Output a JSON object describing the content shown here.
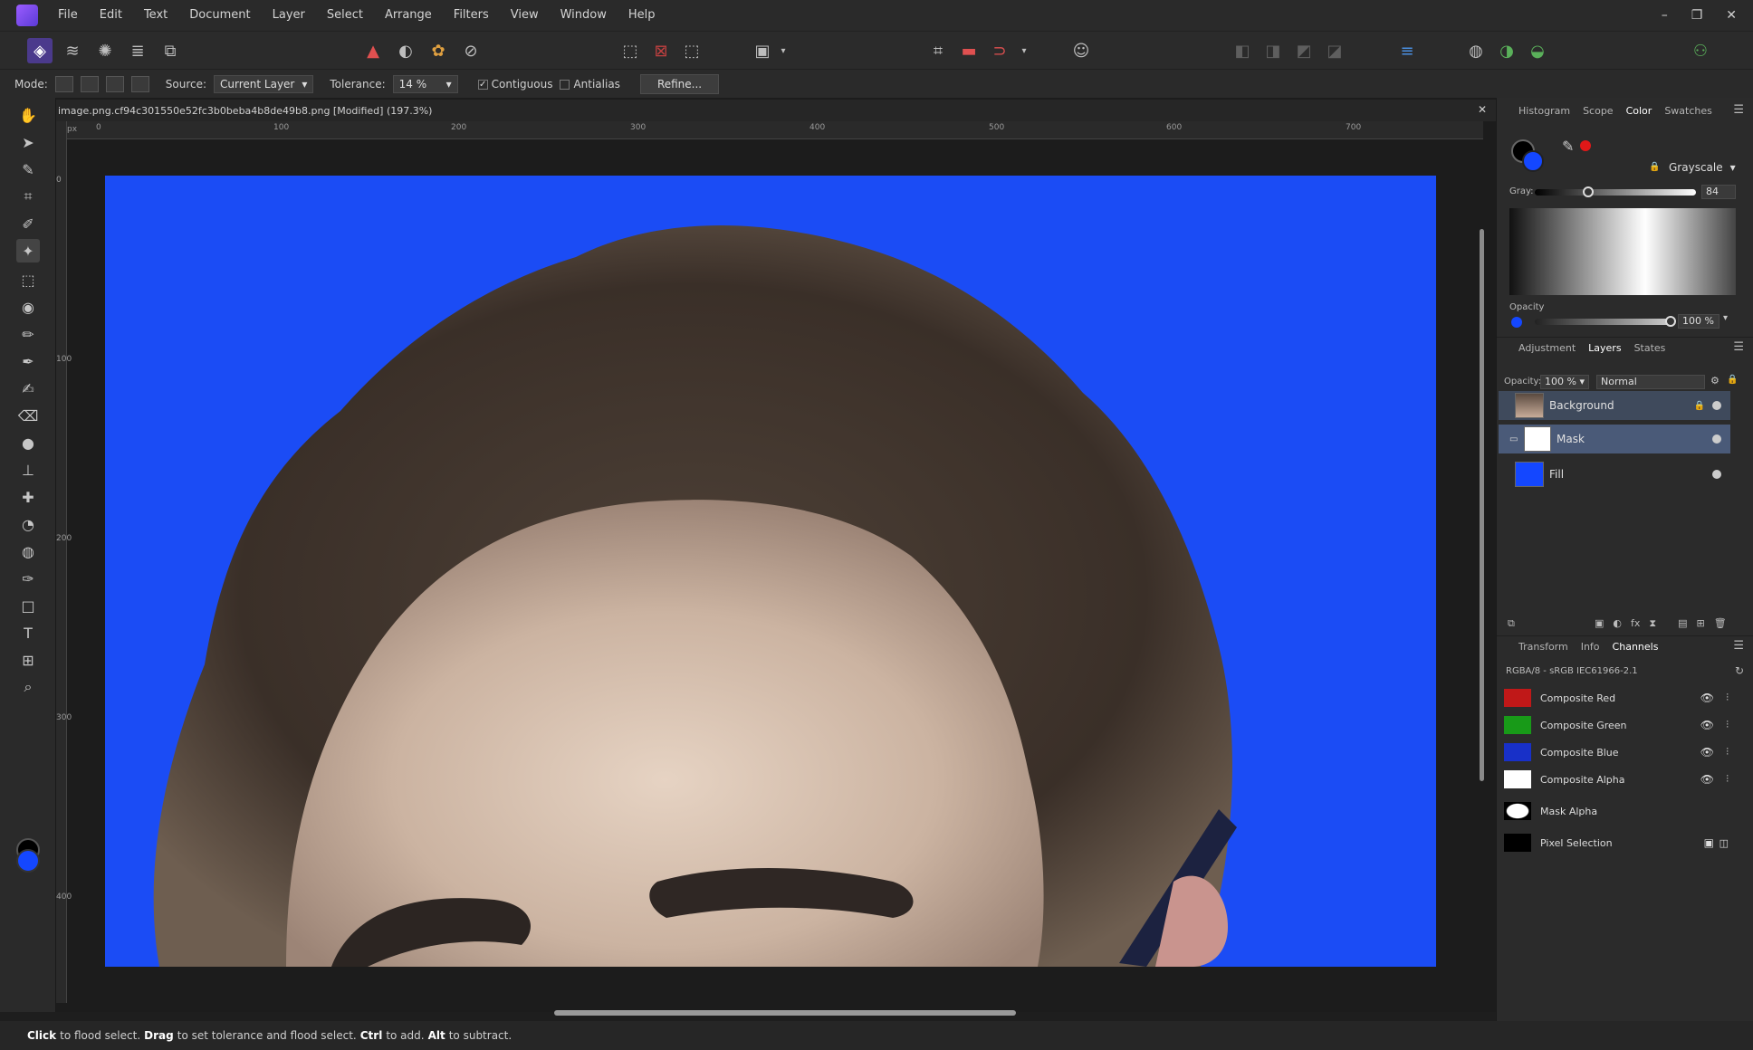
{
  "menu": [
    "File",
    "Edit",
    "Text",
    "Document",
    "Layer",
    "Select",
    "Arrange",
    "Filters",
    "View",
    "Window",
    "Help"
  ],
  "window": {
    "minimize": "–",
    "restore": "❐",
    "close": "✕"
  },
  "context": {
    "mode_label": "Mode:",
    "source_label": "Source:",
    "source_value": "Current Layer",
    "tolerance_label": "Tolerance:",
    "tolerance_value": "14 %",
    "contiguous_label": "Contiguous",
    "antialias_label": "Antialias",
    "refine_label": "Refine..."
  },
  "document": {
    "tab_title": "image.png.cf94c301550e52fc3b0beba4b8de49b8.png [Modified] (197.3%)",
    "ruler_unit": "px",
    "ruler_top": [
      "0",
      "100",
      "200",
      "300",
      "400",
      "500",
      "600",
      "700"
    ],
    "ruler_left": [
      "0",
      "100",
      "200",
      "300",
      "400"
    ]
  },
  "status": {
    "click": "Click",
    "t1": "to flood select.",
    "drag": "Drag",
    "t2": "to set tolerance and flood select.",
    "ctrl": "Ctrl",
    "t3": "to add.",
    "alt": "Alt",
    "t4": "to subtract."
  },
  "color_panel": {
    "tabs": [
      "Histogram",
      "Scope",
      "Color",
      "Swatches"
    ],
    "model": "Grayscale",
    "gray_label": "Gray:",
    "gray_value": "84",
    "gray_level": 0.33,
    "opacity_label": "Opacity",
    "opacity_value": "100 %",
    "opacity_level": 1.0,
    "fg_color": "#000000",
    "bg_color": "#1447ff"
  },
  "layers_panel": {
    "tabs": [
      "Adjustment",
      "Layers",
      "States"
    ],
    "opacity_label": "Opacity:",
    "opacity_value": "100 %",
    "blend_mode": "Normal",
    "layers": [
      {
        "name": "Background"
      },
      {
        "name": "Mask"
      },
      {
        "name": "Fill"
      }
    ]
  },
  "channels_panel": {
    "tabs": [
      "Transform",
      "Info",
      "Channels"
    ],
    "profile": "RGBA/8 - sRGB IEC61966-2.1",
    "channels": [
      {
        "name": "Composite Red"
      },
      {
        "name": "Composite Green"
      },
      {
        "name": "Composite Blue"
      },
      {
        "name": "Composite Alpha"
      },
      {
        "name": "Mask Alpha"
      },
      {
        "name": "Pixel Selection"
      }
    ]
  },
  "colors": {
    "canvas_bg": "#1b4cf5",
    "accent": "#4b3a8c",
    "selection": "#3f4a5c"
  }
}
